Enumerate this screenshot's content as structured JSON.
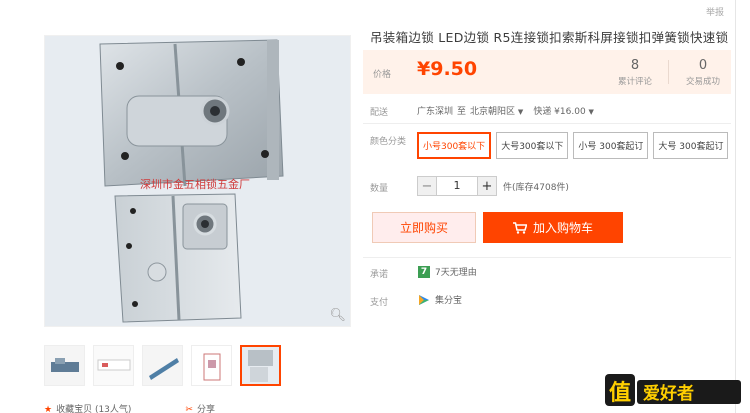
{
  "top": {
    "report": "举报"
  },
  "product": {
    "title": "吊装箱边锁 LED边锁 R5连接锁扣索斯科屏接锁扣弹簧锁快速锁",
    "watermark": "深圳市金五相锁五金厂"
  },
  "price": {
    "label": "价格",
    "value": "¥9.50"
  },
  "stats": [
    {
      "num": "8",
      "label": "累计评论"
    },
    {
      "num": "0",
      "label": "交易成功"
    }
  ],
  "shipping": {
    "label": "配送",
    "from": "广东深圳",
    "to_word": "至",
    "to": "北京朝阳区",
    "method": "快递 ¥16.00"
  },
  "color": {
    "label": "颜色分类",
    "options": [
      "小号300套以下",
      "大号300套以下",
      "小号 300套起订",
      "大号 300套起订"
    ],
    "selected_index": 0
  },
  "quantity": {
    "label": "数量",
    "value": "1",
    "stock": "件(库存4708件)",
    "minus": "−",
    "plus": "+"
  },
  "buttons": {
    "buy": "立即购买",
    "cart": "加入购物车"
  },
  "promise": {
    "label": "承诺",
    "badge": "7",
    "text": "7天无理由"
  },
  "payment": {
    "label": "支付",
    "text": "集分宝"
  },
  "actions": {
    "favorite": "收藏宝贝 (13人气)",
    "share": "分享"
  },
  "logo": {
    "text": "值 | 爱好者"
  },
  "colors": {
    "accent": "#ff4400",
    "price_bg": "#fff2ea",
    "promise_green": "#3c9e53"
  }
}
